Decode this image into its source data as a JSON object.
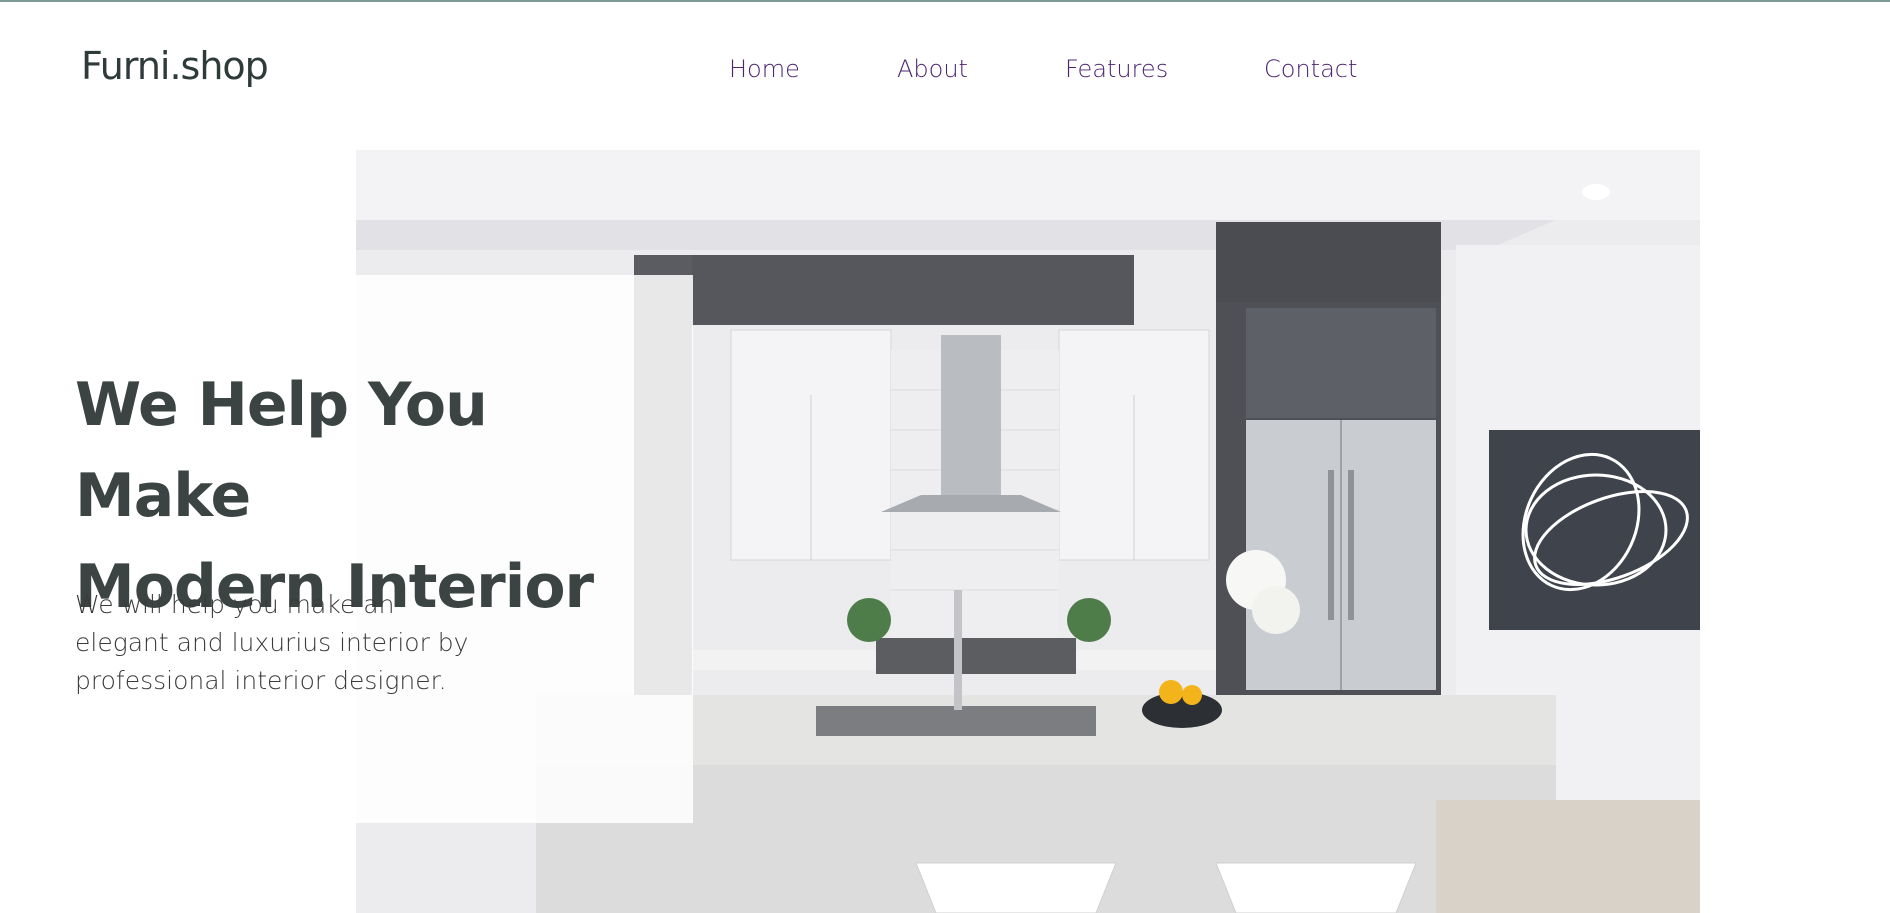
{
  "header": {
    "logo": "Furni.shop",
    "nav": [
      {
        "label": "Home"
      },
      {
        "label": "About"
      },
      {
        "label": "Features"
      },
      {
        "label": "Contact"
      }
    ]
  },
  "hero": {
    "headline_line1": "We Help You Make",
    "headline_line2": "Modern Interior",
    "subtext": "We will help you make an elegant and luxurius interior by professional interior designer.",
    "image_subject": "modern white and dark grey kitchen interior"
  },
  "colors": {
    "nav_text": "#4b2470",
    "heading": "#3b4442",
    "accent_line": "#7d9a94"
  }
}
